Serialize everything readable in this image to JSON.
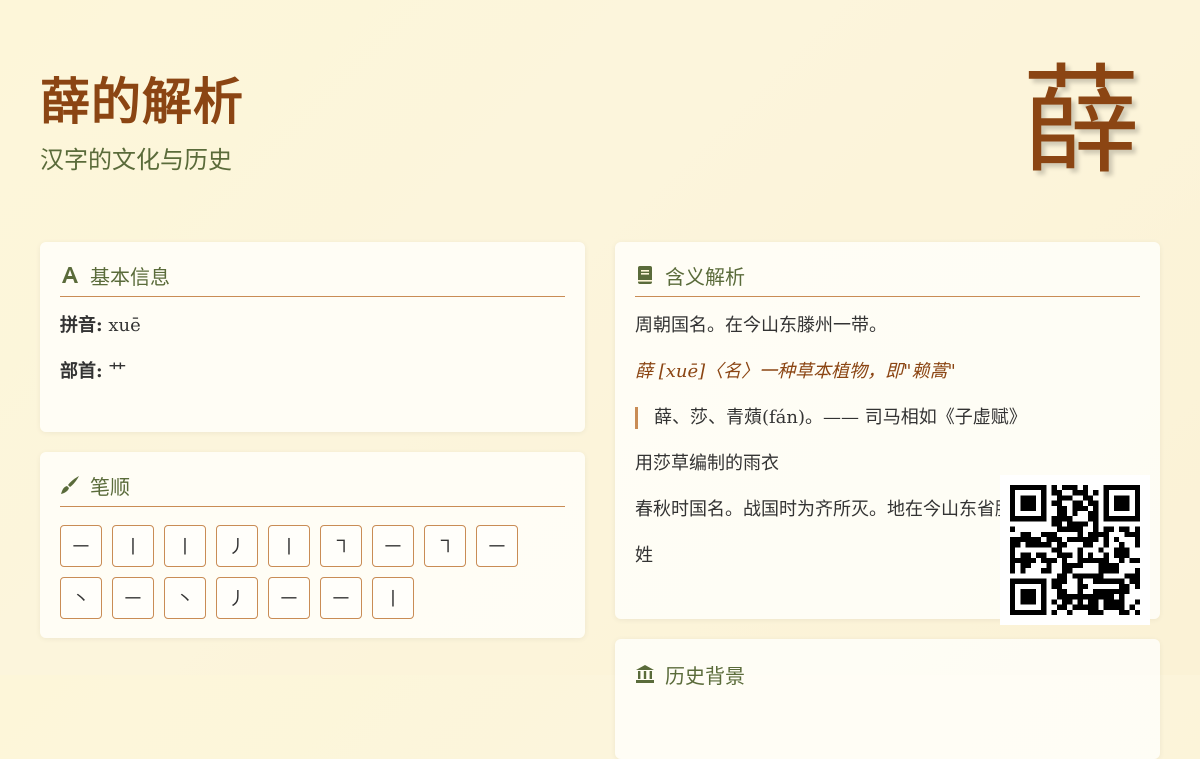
{
  "header": {
    "title": "薛的解析",
    "subtitle": "汉字的文化与历史",
    "big_char": "薛"
  },
  "basic_info": {
    "heading": "基本信息",
    "icon": "font-icon",
    "pinyin_label": "拼音:",
    "pinyin_value": "xuē",
    "radical_label": "部首:",
    "radical_value": "艹"
  },
  "stroke_order": {
    "heading": "笔顺",
    "icon": "brush-icon",
    "strokes": [
      "㇐",
      "丨",
      "丨",
      "丿",
      "丨",
      "㇕",
      "㇐",
      "㇕",
      "㇐",
      "丶",
      "㇐",
      "丶",
      "丿",
      "㇐",
      "㇐",
      "丨"
    ]
  },
  "meaning": {
    "heading": "含义解析",
    "icon": "book-icon",
    "lines": [
      "周朝国名。在今山东滕州一带。",
      "薛 [xuē]〈名〉一种草本植物，即\"赖蒿\"",
      "薛、莎、青薠(fán)。—— 司马相如《子虚赋》",
      "用莎草编制的雨衣",
      "春秋时国名。战国时为齐所灭。地在今山东省滕州南",
      "姓"
    ]
  },
  "history": {
    "heading": "历史背景",
    "icon": "landmark-icon"
  },
  "colors": {
    "accent": "#8b4513",
    "heading_green": "#5a6b3a",
    "border": "#c98c55"
  }
}
